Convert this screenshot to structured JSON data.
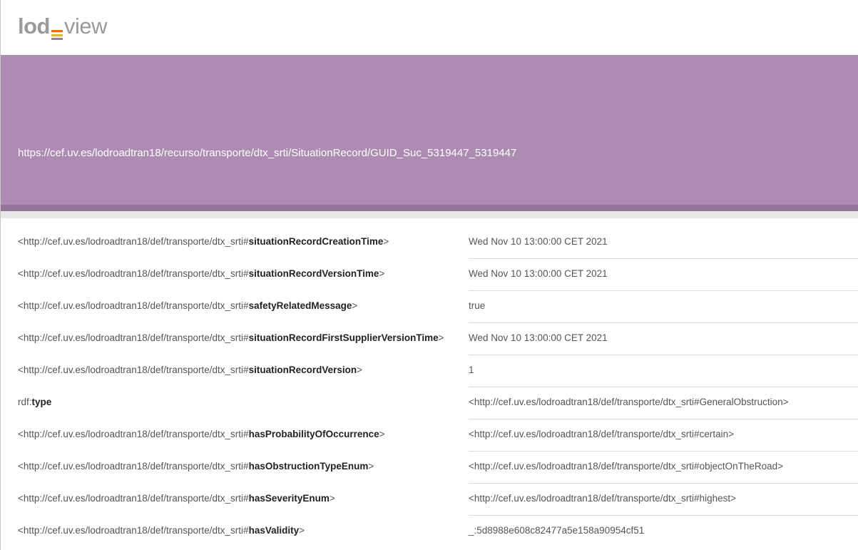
{
  "logo": {
    "part1": "lod",
    "part2": "view",
    "mark_colors": [
      "#d9702f",
      "#e4b43c",
      "#9a7ab0"
    ]
  },
  "resource": {
    "uri": "https://cef.uv.es/lodroadtran18/recurso/transporte/dtx_srti/SituationRecord/GUID_Suc_5319447_5319447"
  },
  "colors": {
    "banner": "#ad8bb3",
    "banner_strip": "#94749a"
  },
  "triples": [
    {
      "pred_prefix": "<http://cef.uv.es/lodroadtran18/def/transporte/dtx_srti#",
      "pred_local": "situationRecordCreationTime",
      "pred_suffix": ">",
      "obj_prefix": "Wed Nov 10 13:00:00 CET 2021",
      "obj_local": "",
      "obj_suffix": ""
    },
    {
      "pred_prefix": "<http://cef.uv.es/lodroadtran18/def/transporte/dtx_srti#",
      "pred_local": "situationRecordVersionTime",
      "pred_suffix": ">",
      "obj_prefix": "Wed Nov 10 13:00:00 CET 2021",
      "obj_local": "",
      "obj_suffix": ""
    },
    {
      "pred_prefix": "<http://cef.uv.es/lodroadtran18/def/transporte/dtx_srti#",
      "pred_local": "safetyRelatedMessage",
      "pred_suffix": ">",
      "obj_prefix": "true",
      "obj_local": "",
      "obj_suffix": ""
    },
    {
      "pred_prefix": "<http://cef.uv.es/lodroadtran18/def/transporte/dtx_srti#",
      "pred_local": "situationRecordFirstSupplierVersionTime",
      "pred_suffix": ">",
      "obj_prefix": "Wed Nov 10 13:00:00 CET 2021",
      "obj_local": "",
      "obj_suffix": ""
    },
    {
      "pred_prefix": "<http://cef.uv.es/lodroadtran18/def/transporte/dtx_srti#",
      "pred_local": "situationRecordVersion",
      "pred_suffix": ">",
      "obj_prefix": "1",
      "obj_local": "",
      "obj_suffix": ""
    },
    {
      "pred_prefix": "rdf:",
      "pred_local": "type",
      "pred_suffix": "",
      "obj_prefix": "<http://cef.uv.es/lodroadtran18/def/transporte/dtx_srti#",
      "obj_local": "GeneralObstruction",
      "obj_suffix": ">"
    },
    {
      "pred_prefix": "<http://cef.uv.es/lodroadtran18/def/transporte/dtx_srti#",
      "pred_local": "hasProbabilityOfOccurrence",
      "pred_suffix": ">",
      "obj_prefix": "<http://cef.uv.es/lodroadtran18/def/transporte/dtx_srti#",
      "obj_local": "certain",
      "obj_suffix": ">"
    },
    {
      "pred_prefix": "<http://cef.uv.es/lodroadtran18/def/transporte/dtx_srti#",
      "pred_local": "hasObstructionTypeEnum",
      "pred_suffix": ">",
      "obj_prefix": "<http://cef.uv.es/lodroadtran18/def/transporte/dtx_srti#",
      "obj_local": "objectOnTheRoad",
      "obj_suffix": ">"
    },
    {
      "pred_prefix": "<http://cef.uv.es/lodroadtran18/def/transporte/dtx_srti#",
      "pred_local": "hasSeverityEnum",
      "pred_suffix": ">",
      "obj_prefix": "<http://cef.uv.es/lodroadtran18/def/transporte/dtx_srti#",
      "obj_local": "highest",
      "obj_suffix": ">"
    },
    {
      "pred_prefix": "<http://cef.uv.es/lodroadtran18/def/transporte/dtx_srti#",
      "pred_local": "hasValidity",
      "pred_suffix": ">",
      "obj_prefix": "_:5d8988e608c82477a5e158a90954cf51",
      "obj_local": "",
      "obj_suffix": ""
    }
  ]
}
